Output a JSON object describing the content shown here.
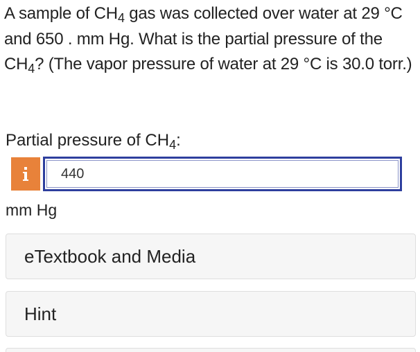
{
  "question": {
    "part1": "A sample of CH",
    "sub1": "4",
    "part2": " gas was collected over water at 29 °C and 650 . mm Hg. What is the partial pressure of the CH",
    "sub2": "4",
    "part3": "? (The vapor pressure of water at 29 °C is 30.0 torr.)"
  },
  "answer": {
    "label_prefix": "Partial pressure of CH",
    "label_sub": "4",
    "label_suffix": ":",
    "info_icon": "info-icon",
    "value": "440",
    "unit": "mm Hg"
  },
  "panels": {
    "etextbook_label": "eTextbook and Media",
    "hint_label": "Hint"
  },
  "colors": {
    "info_badge": "#e8823a",
    "input_border": "#2e3f9e"
  }
}
